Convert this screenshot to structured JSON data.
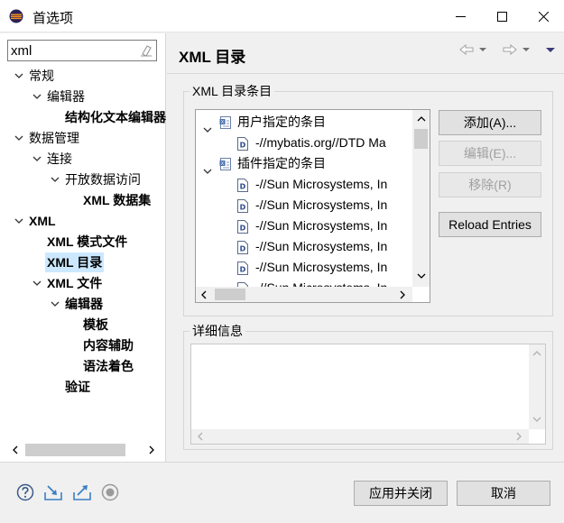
{
  "window": {
    "title": "首选项"
  },
  "filter": {
    "value": "xml"
  },
  "tree": [
    {
      "label": "常规",
      "bold": false,
      "level": 0,
      "twisty": "expanded"
    },
    {
      "label": "编辑器",
      "bold": false,
      "level": 1,
      "twisty": "expanded"
    },
    {
      "label": "结构化文本编辑器",
      "bold": true,
      "level": 2,
      "twisty": "none"
    },
    {
      "label": "数据管理",
      "bold": false,
      "level": 0,
      "twisty": "expanded"
    },
    {
      "label": "连接",
      "bold": false,
      "level": 1,
      "twisty": "expanded"
    },
    {
      "label": "开放数据访问",
      "bold": false,
      "level": 2,
      "twisty": "expanded"
    },
    {
      "label": "XML 数据集",
      "bold": true,
      "level": 3,
      "twisty": "none"
    },
    {
      "label": "XML",
      "bold": true,
      "level": 0,
      "twisty": "expanded"
    },
    {
      "label": "XML 模式文件",
      "bold": true,
      "level": 1,
      "twisty": "none"
    },
    {
      "label": "XML 目录",
      "bold": true,
      "level": 1,
      "twisty": "none",
      "selected": true
    },
    {
      "label": "XML 文件",
      "bold": true,
      "level": 1,
      "twisty": "expanded"
    },
    {
      "label": "编辑器",
      "bold": true,
      "level": 2,
      "twisty": "expanded"
    },
    {
      "label": "模板",
      "bold": true,
      "level": 3,
      "twisty": "none"
    },
    {
      "label": "内容辅助",
      "bold": true,
      "level": 3,
      "twisty": "none"
    },
    {
      "label": "语法着色",
      "bold": true,
      "level": 3,
      "twisty": "none"
    },
    {
      "label": "验证",
      "bold": true,
      "level": 2,
      "twisty": "none"
    }
  ],
  "page": {
    "title": "XML 目录"
  },
  "catalog": {
    "group_label": "XML 目录条目",
    "entries": [
      {
        "label": "用户指定的条目",
        "kind": "folder"
      },
      {
        "label": "-//mybatis.org//DTD Ma",
        "kind": "doc"
      },
      {
        "label": "插件指定的条目",
        "kind": "folder"
      },
      {
        "label": "-//Sun Microsystems, In",
        "kind": "doc"
      },
      {
        "label": "-//Sun Microsystems, In",
        "kind": "doc"
      },
      {
        "label": "-//Sun Microsystems, In",
        "kind": "doc"
      },
      {
        "label": "-//Sun Microsystems, In",
        "kind": "doc"
      },
      {
        "label": "-//Sun Microsystems, In",
        "kind": "doc"
      },
      {
        "label": "-//Sun Microsystems, In",
        "kind": "doc"
      }
    ]
  },
  "buttons": {
    "add": "添加(A)...",
    "edit": "编辑(E)...",
    "remove": "移除(R)",
    "reload": "Reload Entries",
    "apply_close": "应用并关闭",
    "cancel": "取消"
  },
  "details": {
    "group_label": "详细信息"
  },
  "colors": {
    "selection": "#cce8ff",
    "accent_icon": "#3b7fc4"
  }
}
